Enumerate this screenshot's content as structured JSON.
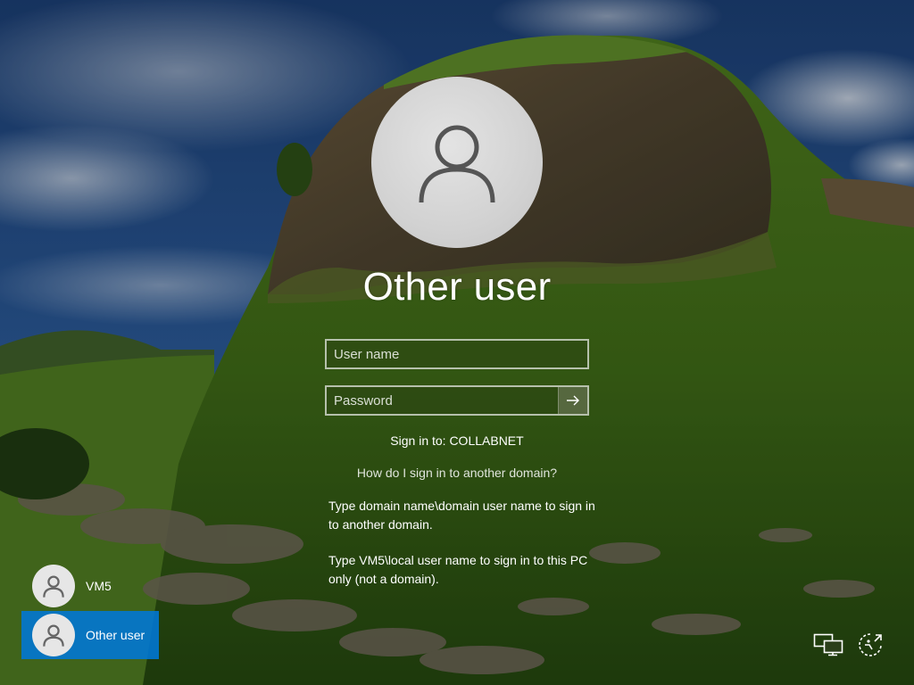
{
  "login": {
    "username": "Other user",
    "username_placeholder": "User name",
    "password_placeholder": "Password",
    "signin_to": "Sign in to: COLLABNET",
    "how_link": "How do I sign in to another domain?",
    "help_line1": "Type domain name\\domain user name to sign in to another domain.",
    "help_line2": "Type VM5\\local user name to sign in to this PC only (not a domain)."
  },
  "users": [
    {
      "label": "VM5",
      "selected": false
    },
    {
      "label": "Other user",
      "selected": true
    }
  ],
  "icons": {
    "avatar": "user-icon",
    "submit": "arrow-right-icon",
    "network": "network-icon",
    "accessibility": "ease-of-access-icon"
  },
  "colors": {
    "selected_tile": "#0078d7"
  }
}
